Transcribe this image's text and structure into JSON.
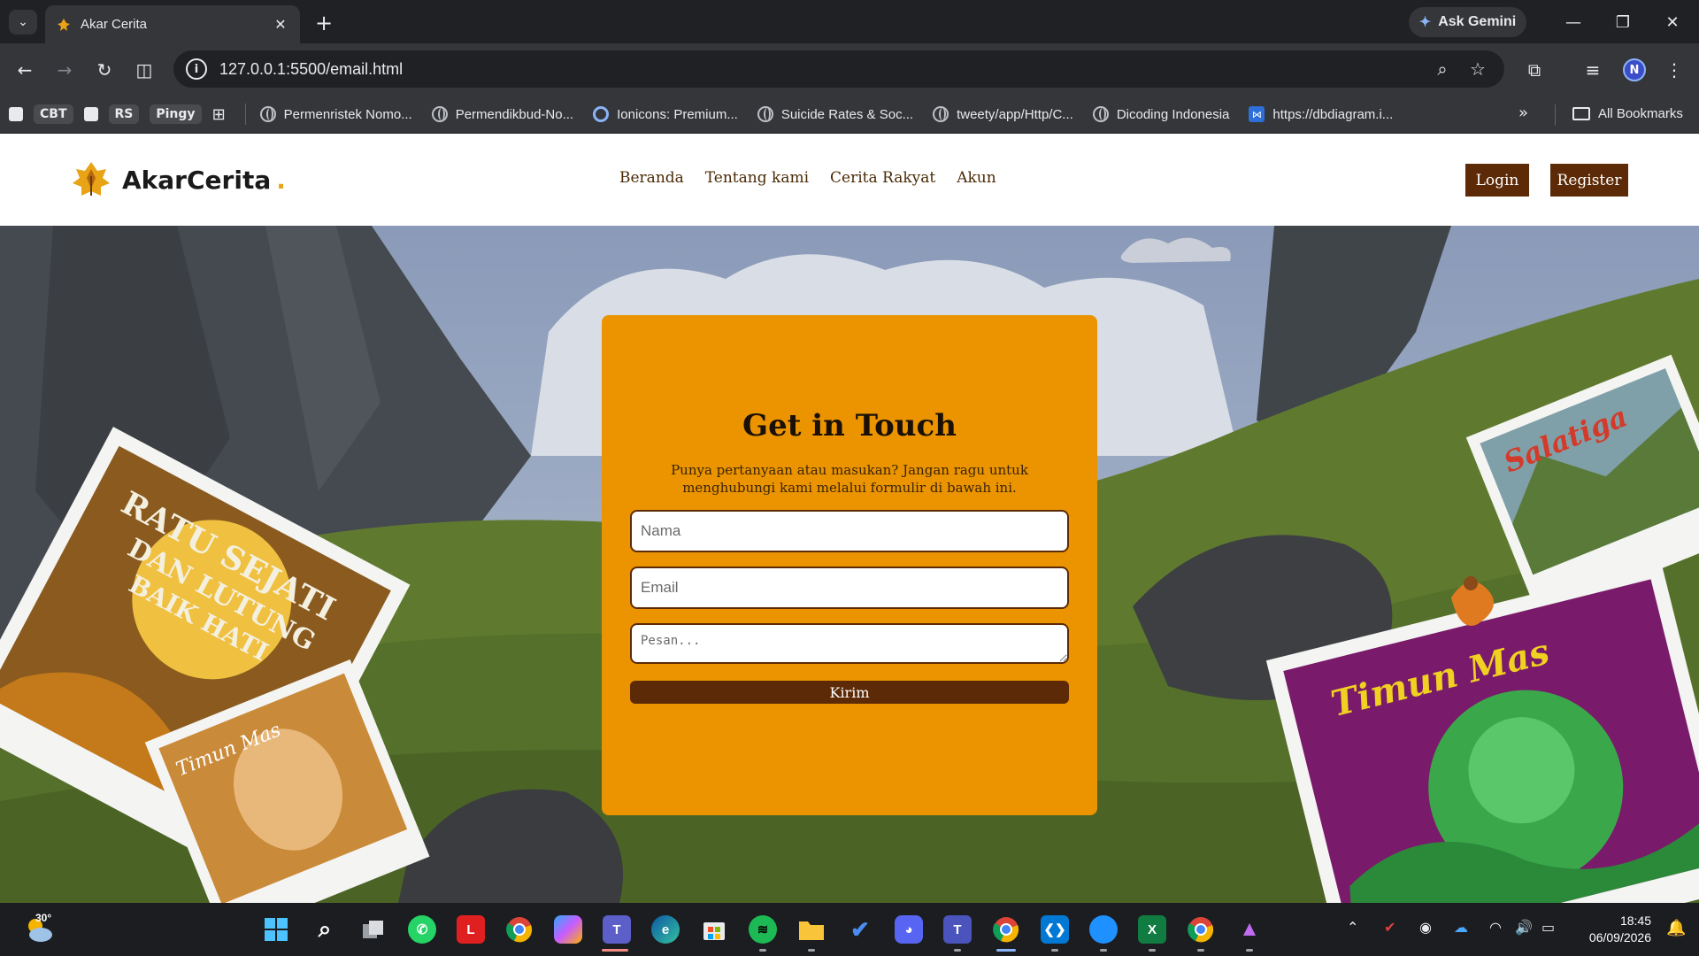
{
  "browser": {
    "tab_title": "Akar Cerita",
    "tab_close": "✕",
    "new_tab": "+",
    "gemini_label": "Ask Gemini",
    "url": "127.0.0.1:5500/email.html",
    "bookmarks": [
      {
        "label": "CBT",
        "kind": "pill"
      },
      {
        "label": "RS",
        "kind": "pill"
      },
      {
        "label": "Pingy",
        "kind": "pill"
      },
      {
        "label": "Permenristek Nomo...",
        "kind": "globe"
      },
      {
        "label": "Permendikbud-No...",
        "kind": "globe"
      },
      {
        "label": "Ionicons: Premium...",
        "kind": "ionicons"
      },
      {
        "label": "Suicide Rates & Soc...",
        "kind": "globe"
      },
      {
        "label": "tweety/app/Http/C...",
        "kind": "globe"
      },
      {
        "label": "Dicoding Indonesia",
        "kind": "globe"
      },
      {
        "label": "https://dbdiagram.i...",
        "kind": "dbdiagram"
      }
    ],
    "all_bookmarks": "All Bookmarks",
    "profile_initial": "N"
  },
  "site": {
    "logo_text": "AkarCerita",
    "logo_dot": ".",
    "nav": [
      "Beranda",
      "Tentang kami",
      "Cerita Rakyat",
      "Akun"
    ],
    "login_label": "Login",
    "register_label": "Register"
  },
  "contact": {
    "title": "Get in Touch",
    "description": "Punya pertanyaan atau masukan? Jangan ragu untuk menghubungi kami melalui formulir di bawah ini.",
    "name_placeholder": "Nama",
    "email_placeholder": "Email",
    "message_placeholder": "Pesan...",
    "submit_label": "Kirim"
  },
  "scene_images": {
    "book_1": "Ratu Sejati dan Lutung Baik Hati",
    "book_2": "Timun Mas",
    "book_3": "Legenda Salatiga",
    "book_4": "Timun Mas"
  },
  "taskbar": {
    "temperature": "30°",
    "time": "18:45",
    "date": "06/09/2026",
    "apps": [
      "windows-start",
      "search",
      "task-view",
      "whatsapp",
      "l-app",
      "chrome",
      "copilot",
      "teams",
      "edge",
      "microsoft-store",
      "spotify",
      "file-explorer",
      "todo",
      "discord",
      "teams-classic",
      "chrome-profile",
      "vscode",
      "app-blue",
      "excel",
      "chrome-alt",
      "app-purple"
    ]
  },
  "colors": {
    "card": "#eb9400",
    "accent_brown": "#5c2a06",
    "logo_dot": "#e8a317"
  }
}
